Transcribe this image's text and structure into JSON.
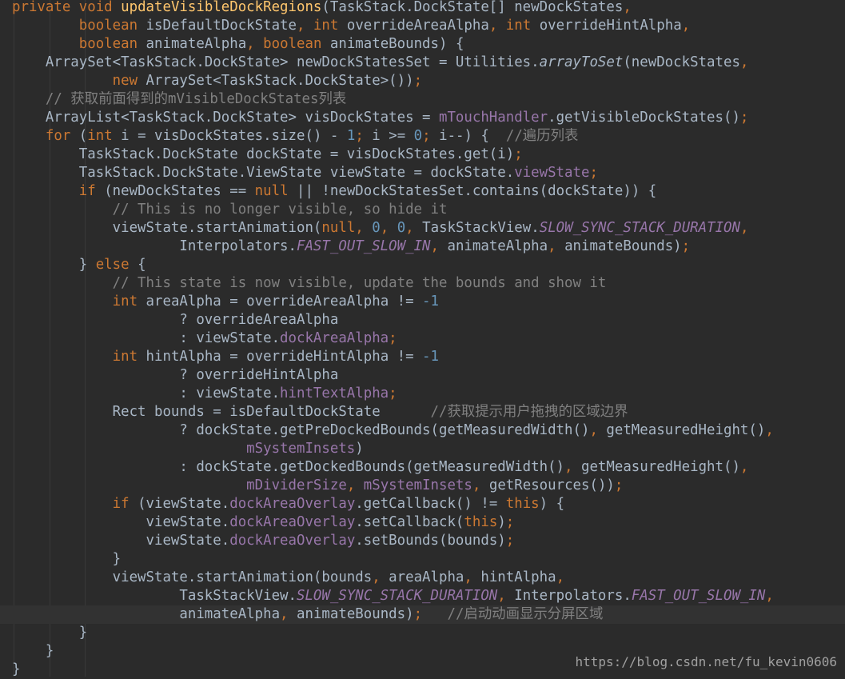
{
  "editor": {
    "current_line_index": 33,
    "lines": [
      [
        [
          "kw",
          "private "
        ],
        [
          "kw",
          "void "
        ],
        [
          "mcall",
          "updateVisibleDockRegions"
        ],
        [
          "txt",
          "(TaskStack.DockState[] newDockStates"
        ],
        [
          "kw",
          ","
        ]
      ],
      [
        [
          "txt",
          "        "
        ],
        [
          "kw",
          "boolean "
        ],
        [
          "txt",
          "isDefaultDockState"
        ],
        [
          "kw",
          ", "
        ],
        [
          "kw",
          "int "
        ],
        [
          "txt",
          "overrideAreaAlpha"
        ],
        [
          "kw",
          ", "
        ],
        [
          "kw",
          "int "
        ],
        [
          "txt",
          "overrideHintAlpha"
        ],
        [
          "kw",
          ","
        ]
      ],
      [
        [
          "txt",
          "        "
        ],
        [
          "kw",
          "boolean "
        ],
        [
          "txt",
          "animateAlpha"
        ],
        [
          "kw",
          ", "
        ],
        [
          "kw",
          "boolean "
        ],
        [
          "txt",
          "animateBounds) {"
        ]
      ],
      [
        [
          "txt",
          "    ArraySet<TaskStack.DockState> newDockStatesSet = Utilities."
        ],
        [
          "smeth",
          "arrayToSet"
        ],
        [
          "txt",
          "(newDockStates"
        ],
        [
          "kw",
          ","
        ]
      ],
      [
        [
          "txt",
          "            "
        ],
        [
          "kw",
          "new "
        ],
        [
          "txt",
          "ArraySet<"
        ],
        [
          "txt",
          "TaskStack.DockState"
        ],
        [
          "txt",
          ">())"
        ],
        [
          "kw",
          ";"
        ]
      ],
      [
        [
          "txt",
          "    "
        ],
        [
          "cmt",
          "// 获取前面得到的mVisibleDockStates列表"
        ]
      ],
      [
        [
          "txt",
          "    ArrayList<TaskStack.DockState> visDockStates = "
        ],
        [
          "fld",
          "mTouchHandler"
        ],
        [
          "txt",
          ".getVisibleDockStates()"
        ],
        [
          "kw",
          ";"
        ]
      ],
      [
        [
          "txt",
          "    "
        ],
        [
          "kw",
          "for "
        ],
        [
          "txt",
          "("
        ],
        [
          "kw",
          "int "
        ],
        [
          "txt",
          "i = visDockStates.size() - "
        ],
        [
          "num",
          "1"
        ],
        [
          "kw",
          "; "
        ],
        [
          "txt",
          "i >= "
        ],
        [
          "num",
          "0"
        ],
        [
          "kw",
          "; "
        ],
        [
          "txt",
          "i--) {  "
        ],
        [
          "cmt",
          "//遍历列表"
        ]
      ],
      [
        [
          "txt",
          "        TaskStack.DockState dockState = visDockStates.get(i)"
        ],
        [
          "kw",
          ";"
        ]
      ],
      [
        [
          "txt",
          "        TaskStack.DockState.ViewState viewState = dockState."
        ],
        [
          "fld",
          "viewState"
        ],
        [
          "kw",
          ";"
        ]
      ],
      [
        [
          "txt",
          "        "
        ],
        [
          "kw",
          "if "
        ],
        [
          "txt",
          "(newDockStates == "
        ],
        [
          "kw",
          "null "
        ],
        [
          "txt",
          "|| !newDockStatesSet.contains(dockState)) {"
        ]
      ],
      [
        [
          "txt",
          "            "
        ],
        [
          "cmt",
          "// This is no longer visible, so hide it"
        ]
      ],
      [
        [
          "txt",
          "            viewState.startAnimation("
        ],
        [
          "kw",
          "null"
        ],
        [
          "kw",
          ", "
        ],
        [
          "num",
          "0"
        ],
        [
          "kw",
          ", "
        ],
        [
          "num",
          "0"
        ],
        [
          "kw",
          ", "
        ],
        [
          "txt",
          "TaskStackView."
        ],
        [
          "sfld",
          "SLOW_SYNC_STACK_DURATION"
        ],
        [
          "kw",
          ","
        ]
      ],
      [
        [
          "txt",
          "                    Interpolators."
        ],
        [
          "sfld",
          "FAST_OUT_SLOW_IN"
        ],
        [
          "kw",
          ", "
        ],
        [
          "txt",
          "animateAlpha"
        ],
        [
          "kw",
          ", "
        ],
        [
          "txt",
          "animateBounds)"
        ],
        [
          "kw",
          ";"
        ]
      ],
      [
        [
          "txt",
          "        } "
        ],
        [
          "kw",
          "else "
        ],
        [
          "txt",
          "{"
        ]
      ],
      [
        [
          "txt",
          "            "
        ],
        [
          "cmt",
          "// This state is now visible, update the bounds and show it"
        ]
      ],
      [
        [
          "txt",
          "            "
        ],
        [
          "kw",
          "int "
        ],
        [
          "txt",
          "areaAlpha = overrideAreaAlpha != "
        ],
        [
          "num",
          "-1"
        ]
      ],
      [
        [
          "txt",
          "                    ? overrideAreaAlpha"
        ]
      ],
      [
        [
          "txt",
          "                    : viewState."
        ],
        [
          "fld",
          "dockAreaAlpha"
        ],
        [
          "kw",
          ";"
        ]
      ],
      [
        [
          "txt",
          "            "
        ],
        [
          "kw",
          "int "
        ],
        [
          "txt",
          "hintAlpha = overrideHintAlpha != "
        ],
        [
          "num",
          "-1"
        ]
      ],
      [
        [
          "txt",
          "                    ? overrideHintAlpha"
        ]
      ],
      [
        [
          "txt",
          "                    : viewState."
        ],
        [
          "fld",
          "hintTextAlpha"
        ],
        [
          "kw",
          ";"
        ]
      ],
      [
        [
          "txt",
          "            Rect bounds = isDefaultDockState      "
        ],
        [
          "cmt",
          "//获取提示用户拖拽的区域边界"
        ]
      ],
      [
        [
          "txt",
          "                    ? dockState.getPreDockedBounds(getMeasuredWidth()"
        ],
        [
          "kw",
          ", "
        ],
        [
          "txt",
          "getMeasuredHeight()"
        ],
        [
          "kw",
          ","
        ]
      ],
      [
        [
          "txt",
          "                            "
        ],
        [
          "fld",
          "mSystemInsets"
        ],
        [
          "txt",
          ")"
        ]
      ],
      [
        [
          "txt",
          "                    : dockState.getDockedBounds(getMeasuredWidth()"
        ],
        [
          "kw",
          ", "
        ],
        [
          "txt",
          "getMeasuredHeight()"
        ],
        [
          "kw",
          ","
        ]
      ],
      [
        [
          "txt",
          "                            "
        ],
        [
          "fld",
          "mDividerSize"
        ],
        [
          "kw",
          ", "
        ],
        [
          "fld",
          "mSystemInsets"
        ],
        [
          "kw",
          ", "
        ],
        [
          "txt",
          "getResources())"
        ],
        [
          "kw",
          ";"
        ]
      ],
      [
        [
          "txt",
          "            "
        ],
        [
          "kw",
          "if "
        ],
        [
          "txt",
          "(viewState."
        ],
        [
          "fld",
          "dockAreaOverlay"
        ],
        [
          "txt",
          ".getCallback() != "
        ],
        [
          "kw",
          "this"
        ],
        [
          "txt",
          ") {"
        ]
      ],
      [
        [
          "txt",
          "                viewState."
        ],
        [
          "fld",
          "dockAreaOverlay"
        ],
        [
          "txt",
          ".setCallback("
        ],
        [
          "kw",
          "this"
        ],
        [
          "txt",
          ")"
        ],
        [
          "kw",
          ";"
        ]
      ],
      [
        [
          "txt",
          "                viewState."
        ],
        [
          "fld",
          "dockAreaOverlay"
        ],
        [
          "txt",
          ".setBounds(bounds)"
        ],
        [
          "kw",
          ";"
        ]
      ],
      [
        [
          "txt",
          "            }"
        ]
      ],
      [
        [
          "txt",
          "            viewState.startAnimation(bounds"
        ],
        [
          "kw",
          ", "
        ],
        [
          "txt",
          "areaAlpha"
        ],
        [
          "kw",
          ", "
        ],
        [
          "txt",
          "hintAlpha"
        ],
        [
          "kw",
          ","
        ]
      ],
      [
        [
          "txt",
          "                    TaskStackView."
        ],
        [
          "sfld",
          "SLOW_SYNC_STACK_DURATION"
        ],
        [
          "kw",
          ", "
        ],
        [
          "txt",
          "Interpolators."
        ],
        [
          "sfld",
          "FAST_OUT_SLOW_IN"
        ],
        [
          "kw",
          ","
        ]
      ],
      [
        [
          "txt",
          "                    animateAlpha"
        ],
        [
          "kw",
          ", "
        ],
        [
          "txt",
          "animateBounds)"
        ],
        [
          "kw",
          ";   "
        ],
        [
          "cmt",
          "//启动动画显示分屏区域"
        ]
      ],
      [
        [
          "txt",
          "        }"
        ]
      ],
      [
        [
          "txt",
          "    }"
        ]
      ],
      [
        [
          "txt",
          "}"
        ]
      ]
    ]
  },
  "watermark": "https://blog.csdn.net/fu_kevin0606"
}
